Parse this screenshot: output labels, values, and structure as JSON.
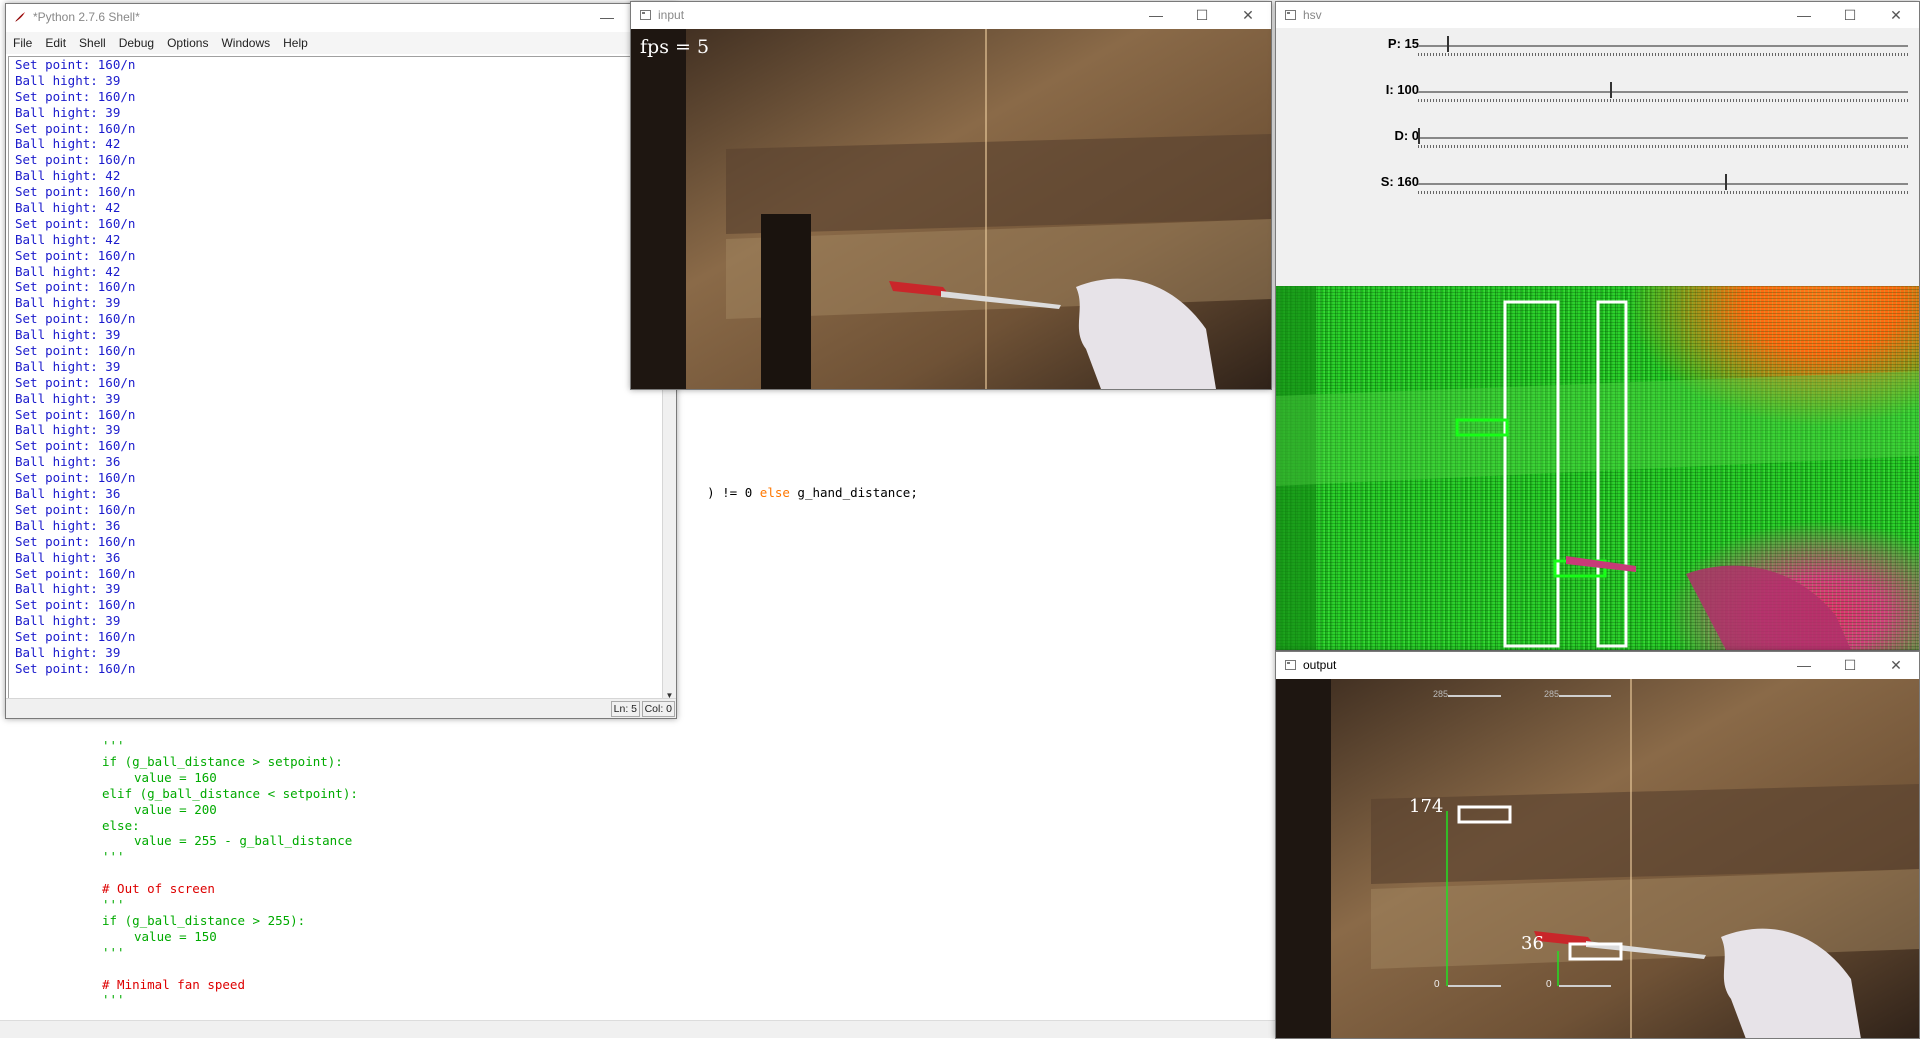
{
  "editor_background": {
    "partial_line": {
      "pre": ") != 0 ",
      "kw": "else",
      "post": " g_hand_distance;"
    },
    "lines": [
      {
        "cls": "c-str",
        "indent": 0,
        "text": "'''"
      },
      {
        "cls": "c-str",
        "indent": 0,
        "text": "if (g_ball_distance > setpoint):"
      },
      {
        "cls": "c-str",
        "indent": 1,
        "text": "value = 160"
      },
      {
        "cls": "c-str",
        "indent": 0,
        "text": "elif (g_ball_distance < setpoint):"
      },
      {
        "cls": "c-str",
        "indent": 1,
        "text": "value = 200"
      },
      {
        "cls": "c-str",
        "indent": 0,
        "text": "else:"
      },
      {
        "cls": "c-str",
        "indent": 1,
        "text": "value = 255 - g_ball_distance"
      },
      {
        "cls": "c-str",
        "indent": 0,
        "text": "'''"
      },
      {
        "cls": "c-str",
        "indent": 0,
        "text": ""
      },
      {
        "cls": "c-com",
        "indent": 0,
        "text": "# Out of screen"
      },
      {
        "cls": "c-str",
        "indent": 0,
        "text": "'''"
      },
      {
        "cls": "c-str",
        "indent": 0,
        "text": "if (g_ball_distance > 255):"
      },
      {
        "cls": "c-str",
        "indent": 1,
        "text": "value = 150"
      },
      {
        "cls": "c-str",
        "indent": 0,
        "text": "'''"
      },
      {
        "cls": "c-str",
        "indent": 0,
        "text": ""
      },
      {
        "cls": "c-com",
        "indent": 0,
        "text": "# Minimal fan speed"
      },
      {
        "cls": "c-str",
        "indent": 0,
        "text": "'''"
      }
    ]
  },
  "shell": {
    "title": "*Python 2.7.6 Shell*",
    "menu": [
      "File",
      "Edit",
      "Shell",
      "Debug",
      "Options",
      "Windows",
      "Help"
    ],
    "output_lines": [
      "Set point: 160/n",
      "Ball hight: 39",
      "Set point: 160/n",
      "Ball hight: 39",
      "Set point: 160/n",
      "Ball hight: 42",
      "Set point: 160/n",
      "Ball hight: 42",
      "Set point: 160/n",
      "Ball hight: 42",
      "Set point: 160/n",
      "Ball hight: 42",
      "Set point: 160/n",
      "Ball hight: 42",
      "Set point: 160/n",
      "Ball hight: 39",
      "Set point: 160/n",
      "Ball hight: 39",
      "Set point: 160/n",
      "Ball hight: 39",
      "Set point: 160/n",
      "Ball hight: 39",
      "Set point: 160/n",
      "Ball hight: 39",
      "Set point: 160/n",
      "Ball hight: 36",
      "Set point: 160/n",
      "Ball hight: 36",
      "Set point: 160/n",
      "Ball hight: 36",
      "Set point: 160/n",
      "Ball hight: 36",
      "Set point: 160/n",
      "Ball hight: 39",
      "Set point: 160/n",
      "Ball hight: 39",
      "Set point: 160/n",
      "Ball hight: 39",
      "Set point: 160/n"
    ],
    "status_ln": "Ln: 5",
    "status_col": "Col: 0"
  },
  "input_window": {
    "title": "input",
    "fps_text": "fps = 5"
  },
  "hsv_window": {
    "title": "hsv",
    "trackbars": [
      {
        "label": "P: 15",
        "value": 15,
        "max": 255
      },
      {
        "label": "I: 100",
        "value": 100,
        "max": 255
      },
      {
        "label": "D: 0",
        "value": 0,
        "max": 255
      },
      {
        "label": "S: 160",
        "value": 160,
        "max": 255
      }
    ]
  },
  "output_window": {
    "title": "output",
    "gauge_left_top": "285",
    "gauge_right_top": "285",
    "gauge_left_bottom": "0",
    "gauge_right_bottom": "0",
    "hand_value": "174",
    "ball_value": "36"
  },
  "colors": {
    "shell_output": "#1a1acc",
    "code_string": "#00aa00",
    "code_comment": "#dd0000",
    "keyword": "#ff7700",
    "hsv_green": "#22bb22"
  }
}
